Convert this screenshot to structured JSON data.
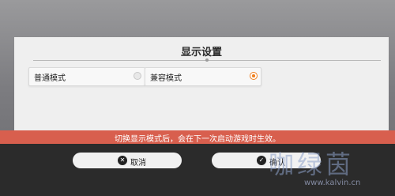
{
  "dialog": {
    "title": "显示设置",
    "options": [
      {
        "label": "普通模式",
        "selected": false
      },
      {
        "label": "兼容模式",
        "selected": true
      }
    ]
  },
  "notice": "切换显示模式后，会在下一次启动游戏时生效。",
  "buttons": {
    "cancel_label": "取消",
    "confirm_label": "确认"
  },
  "watermark": {
    "text": "咖绿茵",
    "url": "www.kalvin.cn"
  },
  "colors": {
    "accent": "#f08020",
    "notice_bar": "#d85f4e",
    "footer": "#2b2b2b"
  },
  "icons": {
    "cancel": "close-circle-icon",
    "confirm": "check-circle-icon"
  }
}
